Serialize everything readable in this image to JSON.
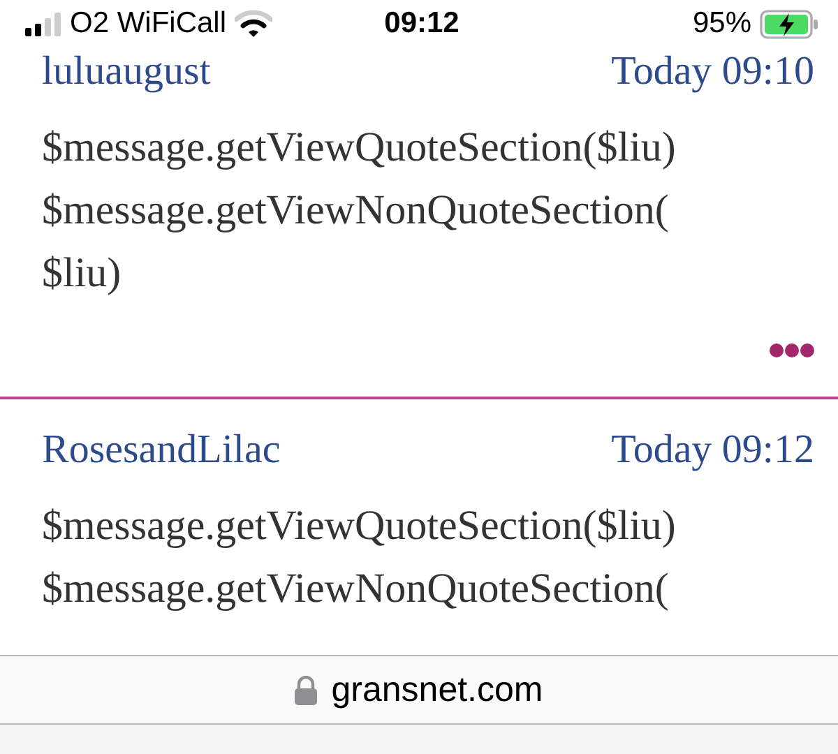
{
  "status_bar": {
    "carrier": "O2 WiFiCall",
    "time": "09:12",
    "battery": "95%"
  },
  "posts": [
    {
      "author": "luluaugust",
      "time": "Today 09:10",
      "lines": [
        "$message.getViewQuoteSection($liu)",
        "$message.getViewNonQuoteSection(",
        "$liu)"
      ],
      "more": true
    },
    {
      "author": "RosesandLilac",
      "time": "Today 09:12",
      "lines": [
        "$message.getViewQuoteSection($liu)",
        "$message.getViewNonQuoteSection("
      ],
      "more": false
    }
  ],
  "address_bar": {
    "url": "gransnet.com",
    "secure": true
  }
}
